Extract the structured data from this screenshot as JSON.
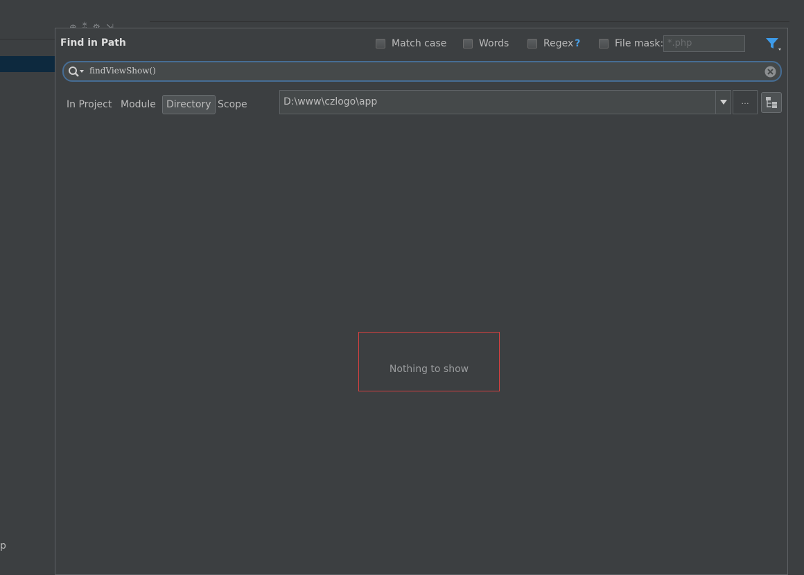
{
  "dialog": {
    "title": "Find in Path",
    "options": {
      "match_case": {
        "label": "Match case",
        "checked": false
      },
      "words": {
        "label": "Words",
        "checked": false
      },
      "regex": {
        "label": "Regex",
        "help": "?",
        "checked": false
      },
      "file_mask": {
        "label": "File mask:",
        "checked": false,
        "placeholder": "*.php"
      }
    },
    "search": {
      "query": "findViewShow()"
    },
    "scope": {
      "tabs": [
        "In Project",
        "Module",
        "Directory",
        "Scope"
      ],
      "selected": "Directory",
      "directory": "D:\\www\\czlogo\\app",
      "browse_label": "…"
    },
    "results": {
      "empty_text": "Nothing to show"
    }
  },
  "ide": {
    "side_label": "p"
  },
  "colors": {
    "background": "#3c3f41",
    "accent_blue": "#4a9fe5",
    "search_border": "#466d94",
    "empty_highlight": "#d84040"
  },
  "icons": [
    "search-icon",
    "clear-icon",
    "filter-icon",
    "chevron-down-icon",
    "folder-tree-icon"
  ]
}
